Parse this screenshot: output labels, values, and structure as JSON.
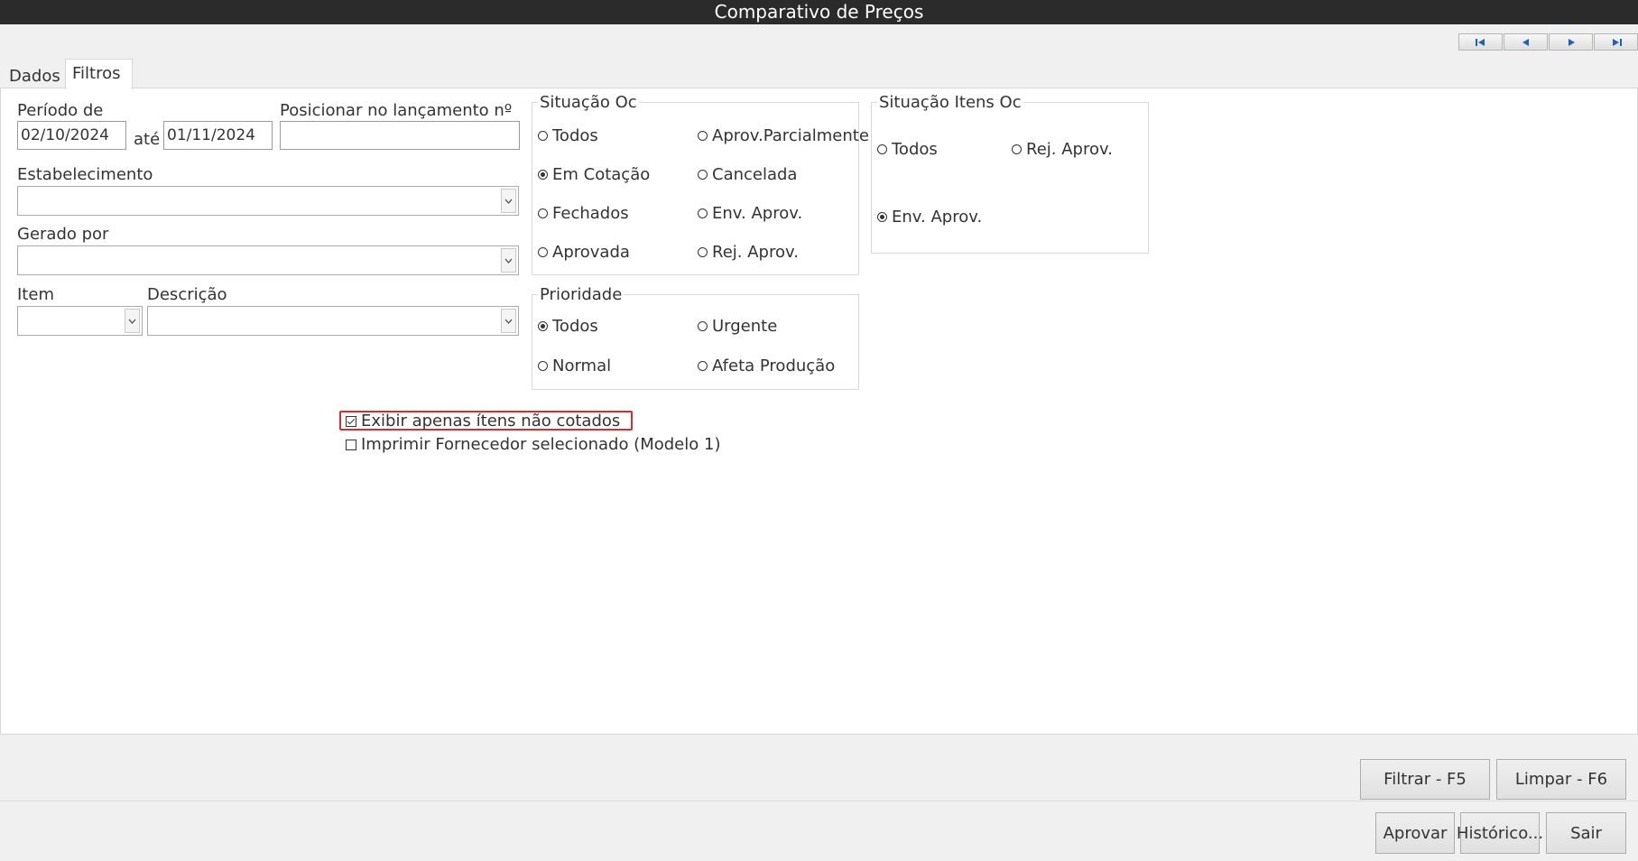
{
  "window": {
    "title": "Comparativo de Preços"
  },
  "nav": {
    "first": "first-record",
    "prev": "previous-record",
    "next": "next-record",
    "last": "last-record"
  },
  "tabs": [
    {
      "label": "Dados"
    },
    {
      "label": "Filtros"
    }
  ],
  "filters": {
    "periodo_label": "Período de",
    "periodo_de": "02/10/2024",
    "ate_label": "até",
    "periodo_ate": "01/11/2024",
    "posicionar_label": "Posicionar no lançamento nº",
    "posicionar_value": "",
    "estabelecimento_label": "Estabelecimento",
    "estabelecimento_value": "",
    "gerado_por_label": "Gerado por",
    "gerado_por_value": "",
    "item_label": "Item",
    "item_value": "",
    "descricao_label": "Descrição",
    "descricao_value": ""
  },
  "situacao_oc": {
    "legend": "Situação Oc",
    "options": [
      {
        "label": "Todos",
        "selected": false
      },
      {
        "label": "Aprov.Parcialmente",
        "selected": false
      },
      {
        "label": "Em Cotação",
        "selected": true
      },
      {
        "label": "Cancelada",
        "selected": false
      },
      {
        "label": "Fechados",
        "selected": false
      },
      {
        "label": "Env. Aprov.",
        "selected": false
      },
      {
        "label": "Aprovada",
        "selected": false
      },
      {
        "label": "Rej. Aprov.",
        "selected": false
      }
    ]
  },
  "situacao_itens_oc": {
    "legend": "Situação Itens Oc",
    "options": [
      {
        "label": "Todos",
        "selected": false
      },
      {
        "label": "Rej. Aprov.",
        "selected": false
      },
      {
        "label": "Env. Aprov.",
        "selected": true
      }
    ]
  },
  "prioridade": {
    "legend": "Prioridade",
    "options": [
      {
        "label": "Todos",
        "selected": true
      },
      {
        "label": "Urgente",
        "selected": false
      },
      {
        "label": "Normal",
        "selected": false
      },
      {
        "label": "Afeta Produção",
        "selected": false
      }
    ]
  },
  "checkboxes": {
    "exibir_nao_cotados": {
      "label": "Exibir apenas ítens não cotados",
      "checked": true
    },
    "imprimir_fornecedor": {
      "label": "Imprimir Fornecedor selecionado (Modelo 1)",
      "checked": false
    }
  },
  "highlight_color": "#d32f2f",
  "buttons": {
    "filtrar": "Filtrar - F5",
    "limpar": "Limpar - F6",
    "aprovar": "Aprovar",
    "historico": "Histórico...",
    "sair": "Sair"
  }
}
